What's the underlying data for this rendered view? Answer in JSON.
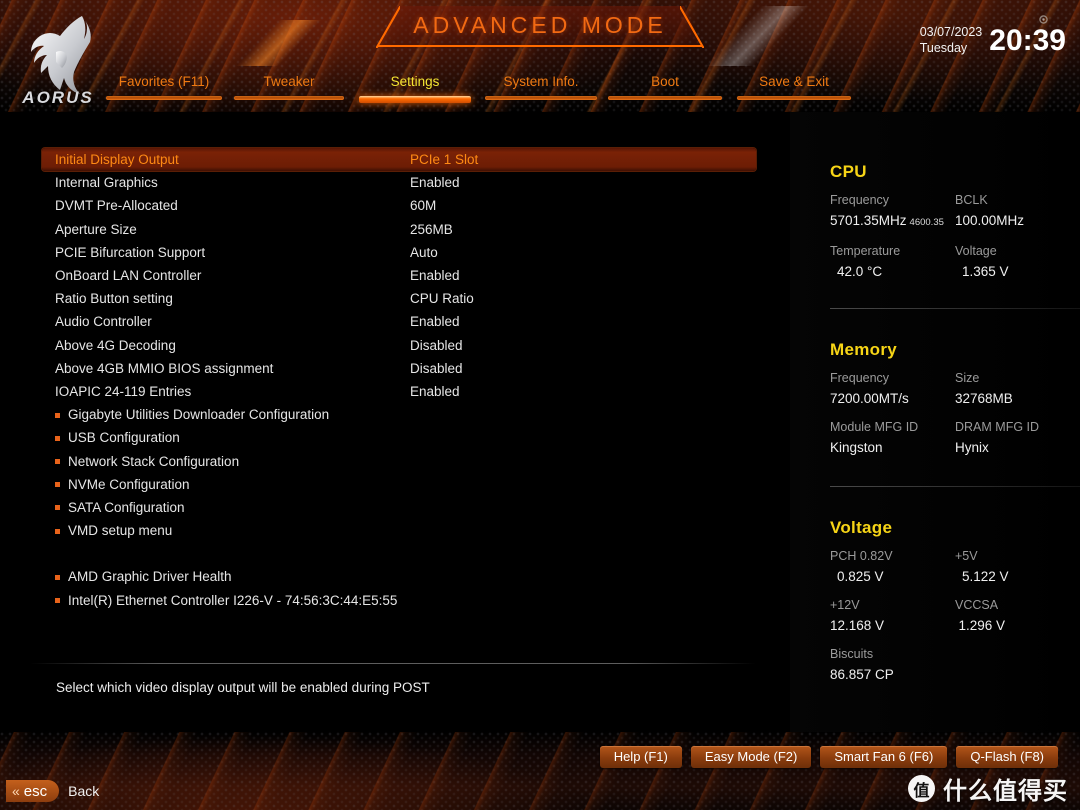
{
  "header": {
    "logo_text": "AORUS",
    "mode_title": "ADVANCED MODE",
    "date": "03/07/2023",
    "weekday": "Tuesday",
    "time": "20:39",
    "tabs": [
      {
        "label": "Favorites (F11)",
        "active": false
      },
      {
        "label": "Tweaker",
        "active": false
      },
      {
        "label": "Settings",
        "active": true
      },
      {
        "label": "System Info.",
        "active": false
      },
      {
        "label": "Boot",
        "active": false
      },
      {
        "label": "Save & Exit",
        "active": false
      }
    ]
  },
  "settings": {
    "rows": [
      {
        "name": "Initial Display Output",
        "value": "PCIe 1 Slot",
        "selected": true,
        "submenu": false
      },
      {
        "name": "Internal Graphics",
        "value": "Enabled",
        "selected": false,
        "submenu": false
      },
      {
        "name": "DVMT Pre-Allocated",
        "value": "60M",
        "selected": false,
        "submenu": false
      },
      {
        "name": "Aperture Size",
        "value": "256MB",
        "selected": false,
        "submenu": false
      },
      {
        "name": "PCIE Bifurcation Support",
        "value": "Auto",
        "selected": false,
        "submenu": false
      },
      {
        "name": "OnBoard LAN Controller",
        "value": "Enabled",
        "selected": false,
        "submenu": false
      },
      {
        "name": "Ratio Button setting",
        "value": "CPU Ratio",
        "selected": false,
        "submenu": false
      },
      {
        "name": "Audio Controller",
        "value": "Enabled",
        "selected": false,
        "submenu": false
      },
      {
        "name": "Above 4G Decoding",
        "value": "Disabled",
        "selected": false,
        "submenu": false
      },
      {
        "name": "Above 4GB MMIO BIOS assignment",
        "value": "Disabled",
        "selected": false,
        "submenu": false
      },
      {
        "name": "IOAPIC 24-119 Entries",
        "value": "Enabled",
        "selected": false,
        "submenu": false
      },
      {
        "name": "Gigabyte Utilities Downloader Configuration",
        "value": "",
        "selected": false,
        "submenu": true
      },
      {
        "name": "USB Configuration",
        "value": "",
        "selected": false,
        "submenu": true
      },
      {
        "name": "Network Stack Configuration",
        "value": "",
        "selected": false,
        "submenu": true
      },
      {
        "name": "NVMe Configuration",
        "value": "",
        "selected": false,
        "submenu": true
      },
      {
        "name": "SATA Configuration",
        "value": "",
        "selected": false,
        "submenu": true
      },
      {
        "name": "VMD setup menu",
        "value": "",
        "selected": false,
        "submenu": true
      },
      {
        "name": "",
        "value": "",
        "selected": false,
        "submenu": false,
        "spacer": true
      },
      {
        "name": "AMD Graphic Driver Health",
        "value": "",
        "selected": false,
        "submenu": true
      },
      {
        "name": "Intel(R) Ethernet Controller I226-V - 74:56:3C:44:E5:55",
        "value": "",
        "selected": false,
        "submenu": true
      }
    ],
    "help_text": "Select which video display output will be enabled during POST"
  },
  "sidebar": {
    "cpu": {
      "title": "CPU",
      "freq_label": "Frequency",
      "freq_value": "5701.35MHz",
      "freq_small": "4600.35",
      "bclk_label": "BCLK",
      "bclk_value": "100.00MHz",
      "temp_label": "Temperature",
      "temp_value": "42.0 °C",
      "volt_label": "Voltage",
      "volt_value": "1.365 V"
    },
    "memory": {
      "title": "Memory",
      "freq_label": "Frequency",
      "freq_value": "7200.00MT/s",
      "size_label": "Size",
      "size_value": "32768MB",
      "module_label": "Module MFG ID",
      "module_value": "Kingston",
      "dram_label": "DRAM MFG ID",
      "dram_value": "Hynix"
    },
    "voltage": {
      "title": "Voltage",
      "pch_label": "PCH 0.82V",
      "pch_value": "0.825 V",
      "v5_label": "+5V",
      "v5_value": "5.122 V",
      "v12_label": "+12V",
      "v12_value": "12.168 V",
      "vccsa_label": "VCCSA",
      "vccsa_value": "1.296 V",
      "biscuits_label": "Biscuits",
      "biscuits_value": "86.857 CP"
    }
  },
  "footer": {
    "buttons": [
      {
        "label": "Help (F1)"
      },
      {
        "label": "Easy Mode (F2)"
      },
      {
        "label": "Smart Fan 6 (F6)"
      },
      {
        "label": "Q-Flash (F8)"
      }
    ],
    "esc_key": "esc",
    "back_label": "Back"
  },
  "watermark": {
    "badge": "值",
    "text": "什么值得买"
  },
  "colors": {
    "accent_orange": "#ef7a12",
    "active_yellow": "#f5e532",
    "section_yellow": "#f7d516",
    "selection_bg": "#7a2206"
  }
}
